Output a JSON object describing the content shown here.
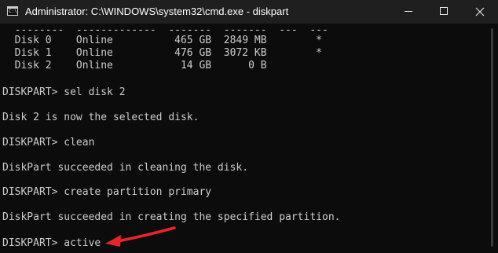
{
  "window": {
    "title": "Administrator: C:\\WINDOWS\\system32\\cmd.exe - diskpart",
    "app_icon_glyph": "C:\\",
    "icons": {
      "app": "cmd-app-icon",
      "minimize": "minimize-icon",
      "maximize": "maximize-icon",
      "close": "close-icon"
    }
  },
  "console": {
    "lines": [
      "  --------  -------------  -------  -------  ---  ---",
      "  Disk 0    Online          465 GB  2849 MB        *",
      "  Disk 1    Online          476 GB  3072 KB        *",
      "  Disk 2    Online           14 GB      0 B",
      "",
      "DISKPART> sel disk 2",
      "",
      "Disk 2 is now the selected disk.",
      "",
      "DISKPART> clean",
      "",
      "DiskPart succeeded in cleaning the disk.",
      "",
      "DISKPART> create partition primary",
      "",
      "DiskPart succeeded in creating the specified partition.",
      "",
      "DISKPART> active"
    ]
  },
  "annotation": {
    "arrow_color": "#e8242b",
    "points_to": "active command"
  },
  "colors": {
    "console_bg": "#0c0c0c",
    "console_text": "#cccccc",
    "titlebar_bg": "#1f1f1f"
  }
}
